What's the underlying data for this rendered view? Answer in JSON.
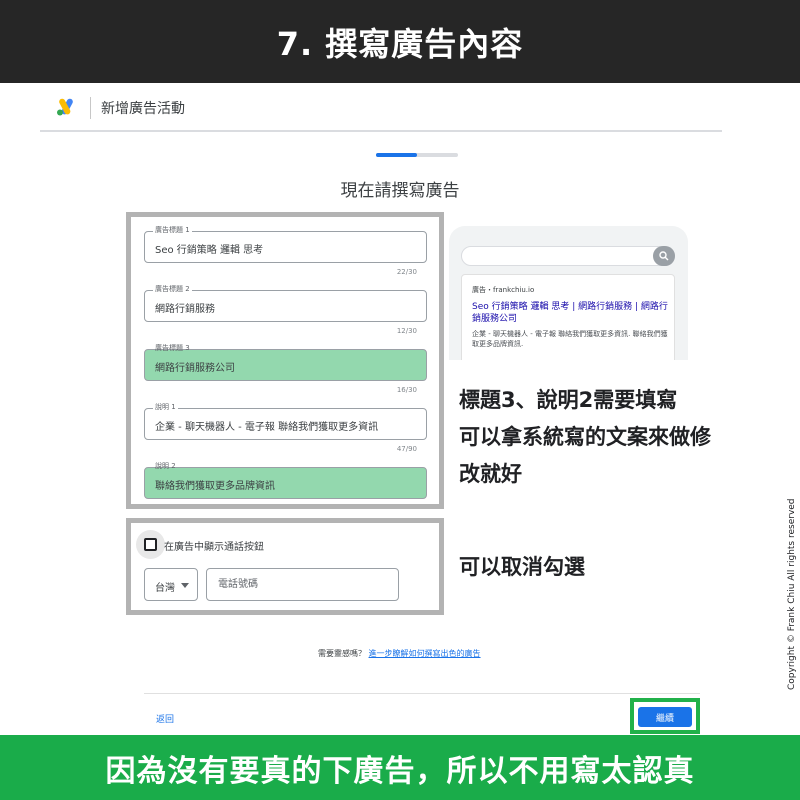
{
  "banner": {
    "title": "7. 撰寫廣告內容"
  },
  "header": {
    "title": "新增廣告活動",
    "logo_icon": "google-ads-logo"
  },
  "progress": {
    "fraction": 0.5
  },
  "page": {
    "heading": "現在請撰寫廣告"
  },
  "fields": [
    {
      "label": "廣告標題 1",
      "value": "Seo 行銷策略 邏輯 思考",
      "counter": "22/30",
      "highlighted": false
    },
    {
      "label": "廣告標題 2",
      "value": "網路行銷服務",
      "counter": "12/30",
      "highlighted": false
    },
    {
      "label": "廣告標題 3",
      "value": "網路行銷服務公司",
      "counter": "16/30",
      "highlighted": true
    },
    {
      "label": "說明 1",
      "value": "企業 - 聊天機器人 - 電子報 聯絡我們獲取更多資訊",
      "counter": "47/90",
      "highlighted": false
    },
    {
      "label": "說明 2",
      "value": "聯絡我們獲取更多品牌資訊",
      "counter": "",
      "highlighted": true
    }
  ],
  "preview": {
    "ad_line": "廣告・frankchiu.io",
    "headline": "Seo 行銷策略 邏輯 思考 | 網路行銷服務 | 網路行銷服務公司",
    "description": "企業 - 聊天機器人 - 電子報 聯絡我們獲取更多資訊. 聯絡我們獲取更多品牌資訊.",
    "search_icon": "search-icon"
  },
  "annotations": {
    "fill_note_line1": "標題3、說明2需要填寫",
    "fill_note_line2": "可以拿系統寫的文案來做修",
    "fill_note_line3": "改就好",
    "uncheck_note": "可以取消勾選"
  },
  "call": {
    "checkbox_label": "在廣告中顯示通話按鈕",
    "checked": false,
    "country": "台灣",
    "phone_placeholder": "電話號碼"
  },
  "help": {
    "question": "需要靈感嗎？",
    "link": "進一步瞭解如何撰寫出色的廣告"
  },
  "footer": {
    "back": "返回",
    "continue": "繼續"
  },
  "copyright": "Copyright © Frank Chiu All rights reserved",
  "bottom_banner": {
    "text": "因為沒有要真的下廣告，所以不用寫太認真"
  },
  "colors": {
    "highlight_green": "#93d8ae",
    "banner_green": "#1aac4a",
    "accent_blue": "#1a73e8"
  }
}
